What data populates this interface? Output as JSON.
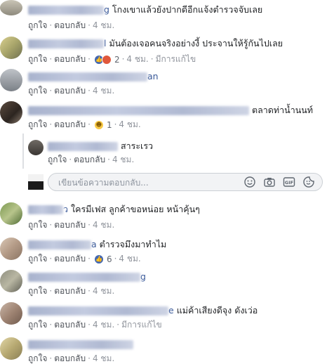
{
  "actions": {
    "like": "ถูกใจ",
    "reply": "ตอบกลับ",
    "sep": "·",
    "edited": "มีการแก้ไข",
    "time": "4 ชม."
  },
  "comments": [
    {
      "name_tail": "g",
      "text": "โกงเขาแล้วยังปากดีอีกแจ้งตำรวจจับเลย"
    },
    {
      "name_tail": "l",
      "text": "มันต้องเจอคนจริงอย่างงี้ ประจานให้รู้กันไปเลย",
      "reaction_count": "2"
    },
    {
      "name_tail": "an",
      "text": ""
    },
    {
      "name_tail": "",
      "text": "ตลาดท่าน้ำนนท์",
      "reaction_count": "1"
    },
    {
      "name_tail": "",
      "text": "สาระเรว"
    },
    {
      "name_tail": "ว",
      "text": "ใครมีเฟส ลูกค้าขอหน่อย หน้าคุ้นๆ"
    },
    {
      "name_tail": "a",
      "text": "ตำรวจมึงมาทำไม",
      "reaction_count": "6"
    },
    {
      "name_tail": "g",
      "text": ""
    },
    {
      "name_tail": "e",
      "text": "แม่ค้าเสียงดีจุง ดังเว่อ"
    },
    {
      "name_tail": "",
      "text": ""
    }
  ],
  "reply_box": {
    "placeholder": "เขียนข้อความตอบกลับ..."
  },
  "icons": {
    "emoji": "emoji-icon",
    "camera": "camera-icon",
    "gif": "gif-icon",
    "sticker": "sticker-icon"
  },
  "colors": {
    "like": "#4267b2",
    "angry": "#e0583c",
    "haha": "#f7c845",
    "meta_text": "#616770"
  }
}
